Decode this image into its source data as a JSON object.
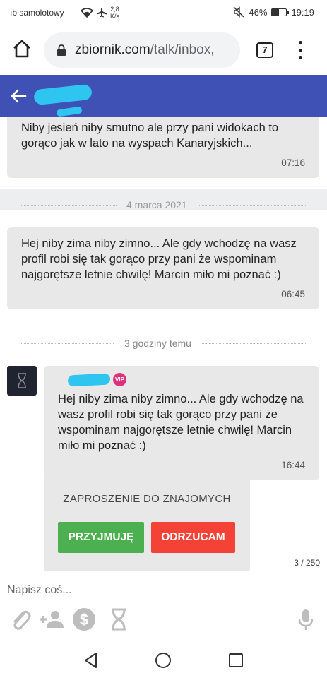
{
  "status_bar": {
    "carrier": "ıb samolotowy",
    "net_speed_value": "2,8",
    "net_speed_unit": "K/s",
    "battery": "46%",
    "battery_level": 0.46,
    "time": "19:19"
  },
  "browser": {
    "url_host": "zbiornik.com",
    "url_path": "/talk/inbox,",
    "tab_count": "7"
  },
  "messages": [
    {
      "text": "Niby jesień niby smutno ale przy pani widokach to gorąco jak w lato na wyspach Kanaryjskich...",
      "time": "07:16"
    },
    {
      "text": "Hej niby zima niby zimno... Ale gdy wchodzę na wasz profil robi się tak gorąco przy pani że wspominam najgorętsze letnie chwilę! Marcin miło mi poznać :)",
      "time": "06:45"
    },
    {
      "text": "Hej niby zima niby zimno... Ale gdy wchodzę na wasz profil robi się tak gorąco przy pani że wspominam najgorętsze letnie chwilę! Marcin miło mi poznać :)",
      "time": "16:44",
      "badge": "VIP"
    }
  ],
  "separators": {
    "date": "4 marca 2021",
    "relative": "3 godziny temu"
  },
  "invite": {
    "title": "ZAPROSZENIE DO ZNAJOMYCH",
    "accept": "PRZYJMUJĘ",
    "reject": "ODRZUCAM"
  },
  "counter": "3 / 250",
  "composer": {
    "placeholder": "Napisz coś..."
  },
  "icons": {
    "back": "arrow-left-icon",
    "home": "home-icon",
    "lock": "lock-icon",
    "attach": "paperclip-icon",
    "add_friend": "add-person-icon",
    "money": "dollar-icon",
    "hourglass": "hourglass-icon",
    "mic": "microphone-icon"
  },
  "colors": {
    "header": "#3f51b5",
    "accept": "#4caf50",
    "reject": "#f44336",
    "vip": "#e0307d",
    "bubble": "#e8e8e8"
  }
}
